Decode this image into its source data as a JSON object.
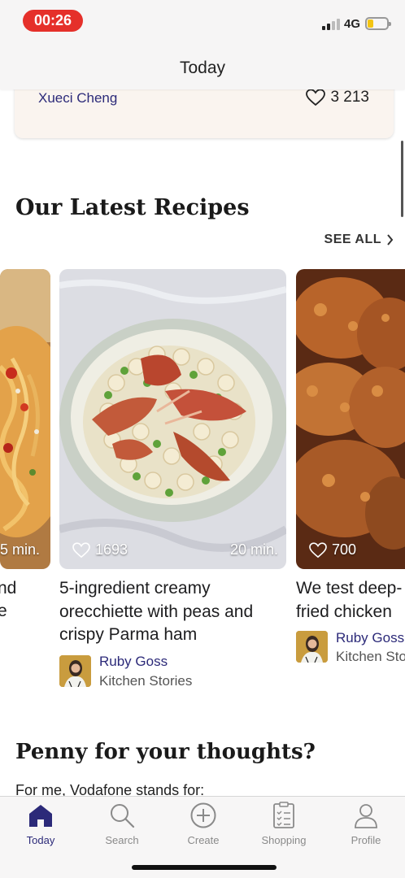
{
  "status": {
    "time": "00:26",
    "network": "4G"
  },
  "nav": {
    "title": "Today"
  },
  "previous_card": {
    "author": "Xueci Cheng",
    "likes": "3 213"
  },
  "latest": {
    "title": "Our Latest Recipes",
    "see_all": "SEE ALL",
    "cards": [
      {
        "time": "5 min.",
        "title_line1": "nd",
        "title_line2": "e"
      },
      {
        "likes": "1693",
        "time": "20 min.",
        "title": "5-ingredient creamy orecchiette with peas and crispy Parma ham",
        "author": "Ruby Goss",
        "org": "Kitchen Stories"
      },
      {
        "likes": "700",
        "title": "We test deep-fried chicken",
        "author": "Ruby Goss",
        "org": "Kitchen Sto"
      }
    ]
  },
  "survey": {
    "title": "Penny for your thoughts?",
    "subtitle": "For me, Vodafone stands for:"
  },
  "tabs": [
    {
      "label": "Today",
      "icon": "home-icon",
      "active": true
    },
    {
      "label": "Search",
      "icon": "search-icon"
    },
    {
      "label": "Create",
      "icon": "plus-circle-icon"
    },
    {
      "label": "Shopping",
      "icon": "shopping-list-icon"
    },
    {
      "label": "Profile",
      "icon": "person-icon"
    }
  ],
  "colors": {
    "accent": "#2c2a79",
    "recording_pill": "#e5302a",
    "card_bg": "#faf4ef"
  }
}
